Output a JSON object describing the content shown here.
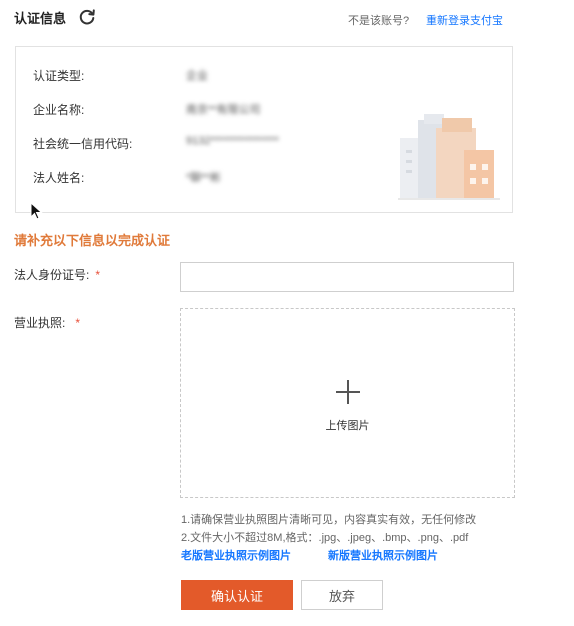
{
  "header": {
    "title": "认证信息",
    "not_account_text": "不是该账号?",
    "relogin_link": "重新登录支付宝"
  },
  "info": {
    "rows": [
      {
        "label": "认证类型:",
        "value": "企业"
      },
      {
        "label": "企业名称:",
        "value": "南京**有限公司"
      },
      {
        "label": "社会统一信用代码:",
        "value": "9132****************"
      },
      {
        "label": "法人姓名:",
        "value": "*聊**彬"
      }
    ]
  },
  "form": {
    "supplement_title": "请补充以下信息以完成认证",
    "id_label": "法人身份证号:",
    "id_value": "",
    "id_placeholder": "",
    "license_label": "营业执照:",
    "required_mark": "*",
    "upload_label": "上传图片"
  },
  "tips": {
    "line1": "1.请确保营业执照图片清晰可见，内容真实有效，无任何修改",
    "line2": "2.文件大小不超过8M,格式：.jpg、.jpeg、.bmp、.png、.pdf",
    "old_sample_link": "老版营业执照示例图片",
    "new_sample_link": "新版营业执照示例图片"
  },
  "buttons": {
    "confirm": "确认认证",
    "abandon": "放弃"
  },
  "icons": {
    "refresh": "refresh-icon",
    "plus": "plus-icon",
    "building": "building-illustration",
    "cursor": "mouse-cursor-icon"
  },
  "colors": {
    "accent_orange": "#e35a2a",
    "warning_orange": "#e07a3a",
    "link_blue": "#1677ff",
    "required_red": "#e8503a"
  }
}
